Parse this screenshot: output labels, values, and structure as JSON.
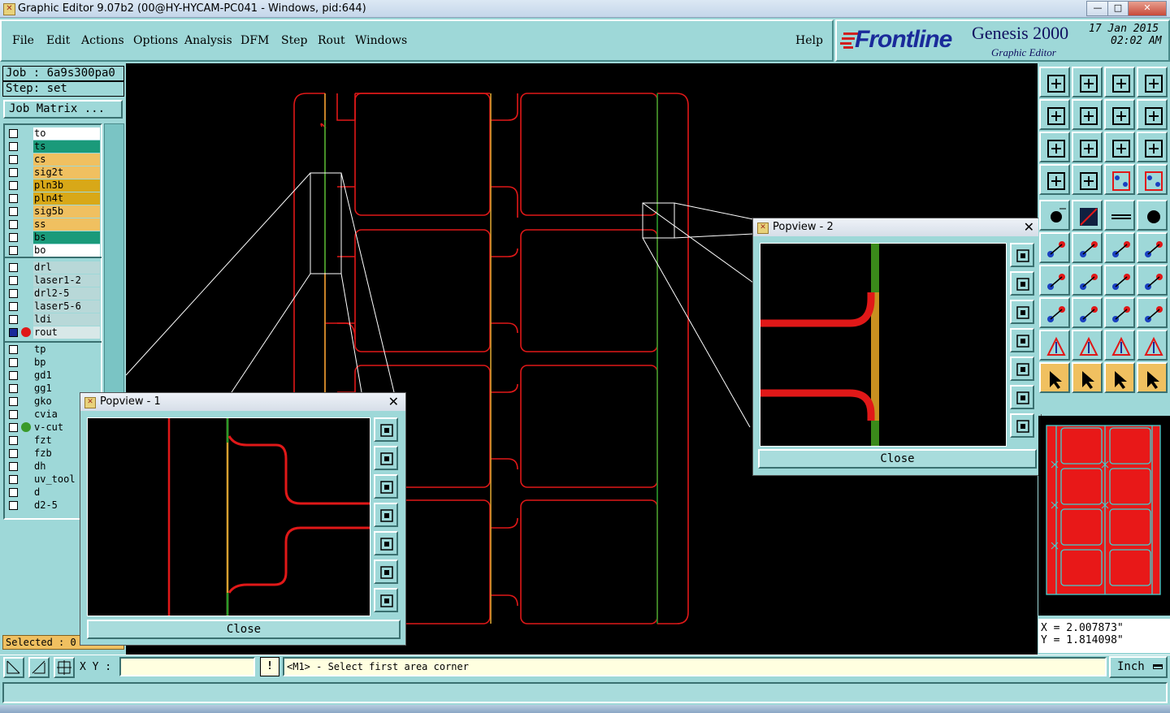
{
  "window": {
    "title": "Graphic Editor 9.07b2 (00@HY-HYCAM-PC041 - Windows, pid:644)",
    "min": "—",
    "max": "□",
    "close": "✕"
  },
  "menu": {
    "items": [
      "File",
      "Edit",
      "Actions",
      "Options",
      "Analysis",
      "DFM",
      "Step",
      "Rout",
      "Windows"
    ],
    "help": "Help"
  },
  "brand": {
    "logo": "Frontline",
    "product": "Genesis 2000",
    "subtitle": "Graphic Editor",
    "date": "17 Jan 2015",
    "time": "02:02 AM"
  },
  "job": {
    "job": "Job : 6a9s300pa0",
    "step": "Step: set",
    "matrix": "Job Matrix ..."
  },
  "layers": {
    "board": [
      {
        "name": "to",
        "color": "#ffffff"
      },
      {
        "name": "ts",
        "color": "#1a9a7a"
      },
      {
        "name": "cs",
        "color": "#f0c060"
      },
      {
        "name": "sig2t",
        "color": "#f0c060"
      },
      {
        "name": "pln3b",
        "color": "#d8a818"
      },
      {
        "name": "pln4t",
        "color": "#d8a818"
      },
      {
        "name": "sig5b",
        "color": "#f0c060"
      },
      {
        "name": "ss",
        "color": "#f0c060"
      },
      {
        "name": "bs",
        "color": "#1a9a7a"
      },
      {
        "name": "bo",
        "color": "#ffffff"
      }
    ],
    "drill": [
      {
        "name": "drl"
      },
      {
        "name": "laser1-2"
      },
      {
        "name": "drl2-5"
      },
      {
        "name": "laser5-6"
      },
      {
        "name": "ldi"
      },
      {
        "name": "rout"
      }
    ],
    "misc": [
      {
        "name": "tp"
      },
      {
        "name": "bp"
      },
      {
        "name": "gd1"
      },
      {
        "name": "gg1"
      },
      {
        "name": "gko"
      },
      {
        "name": "cvia"
      },
      {
        "name": "v-cut"
      },
      {
        "name": "fzt"
      },
      {
        "name": "fzb"
      },
      {
        "name": "dh"
      },
      {
        "name": "uv_tool"
      },
      {
        "name": "d"
      },
      {
        "name": "d2-5"
      }
    ]
  },
  "selected": "Selected : 0",
  "popview1": {
    "title": "Popview - 1",
    "close": "Close"
  },
  "popview2": {
    "title": "Popview - 2",
    "close": "Close"
  },
  "coords": {
    "x": "X = 2.007873\"",
    "y": "Y = 1.814098\""
  },
  "status": {
    "xy_label": "X Y :",
    "xy_value": "",
    "message": "<M1> - Select first area corner",
    "units": "Inch",
    "exclaim": "!"
  },
  "toolbar_icons": [
    "zoom-home-icon",
    "zoom-pan-icon",
    "home-icon",
    "window-icon",
    "pan-left-icon",
    "pan-right-icon",
    "flip-icon",
    "swap-icon",
    "fit-icon",
    "zoom-center-icon",
    "scale-1-2-icon",
    "help-icon",
    "tools-icon",
    "grid-icon",
    "layers-snap-icon",
    "layers-snap2-icon",
    "select-feature-icon",
    "color-icon",
    "ruler-icon",
    "pad-icon",
    "connect-icon",
    "cross-icon",
    "line-icon",
    "line-add-icon",
    "slope-icon",
    "diag-icon",
    "rotate-icon",
    "text-icon",
    "node-icon",
    "minus-icon",
    "measure-icon",
    "shape-icon",
    "triangle-icon",
    "triangle2-icon",
    "triangle3-icon",
    "triangle4-icon",
    "pointer-icon",
    "pointer2-icon",
    "pointer3-icon",
    "pointer4-icon"
  ]
}
